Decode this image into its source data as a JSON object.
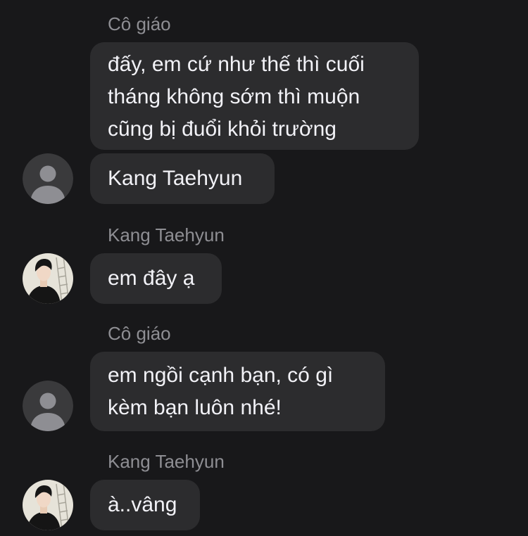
{
  "messages": [
    {
      "sender": "Cô giáo",
      "lines": [
        "đấy, em cứ như thế thì cuối",
        "tháng không sớm thì muộn",
        "cũng bị đuổi khỏi trường"
      ]
    },
    {
      "lines": [
        "Kang Taehyun"
      ]
    },
    {
      "sender": "Kang Taehyun",
      "lines": [
        "em đây ạ"
      ]
    },
    {
      "sender": "Cô giáo",
      "lines": [
        "em ngồi cạnh bạn, có gì",
        "kèm bạn luôn nhé!"
      ]
    },
    {
      "sender": "Kang Taehyun",
      "lines": [
        "à..vâng"
      ]
    }
  ],
  "avatars": {
    "teacher": "default-person-icon",
    "student": "profile-photo"
  },
  "colors": {
    "background": "#18181a",
    "bubble": "#2c2c2e",
    "text": "#f2f2f7",
    "sender": "#8e8e93"
  }
}
